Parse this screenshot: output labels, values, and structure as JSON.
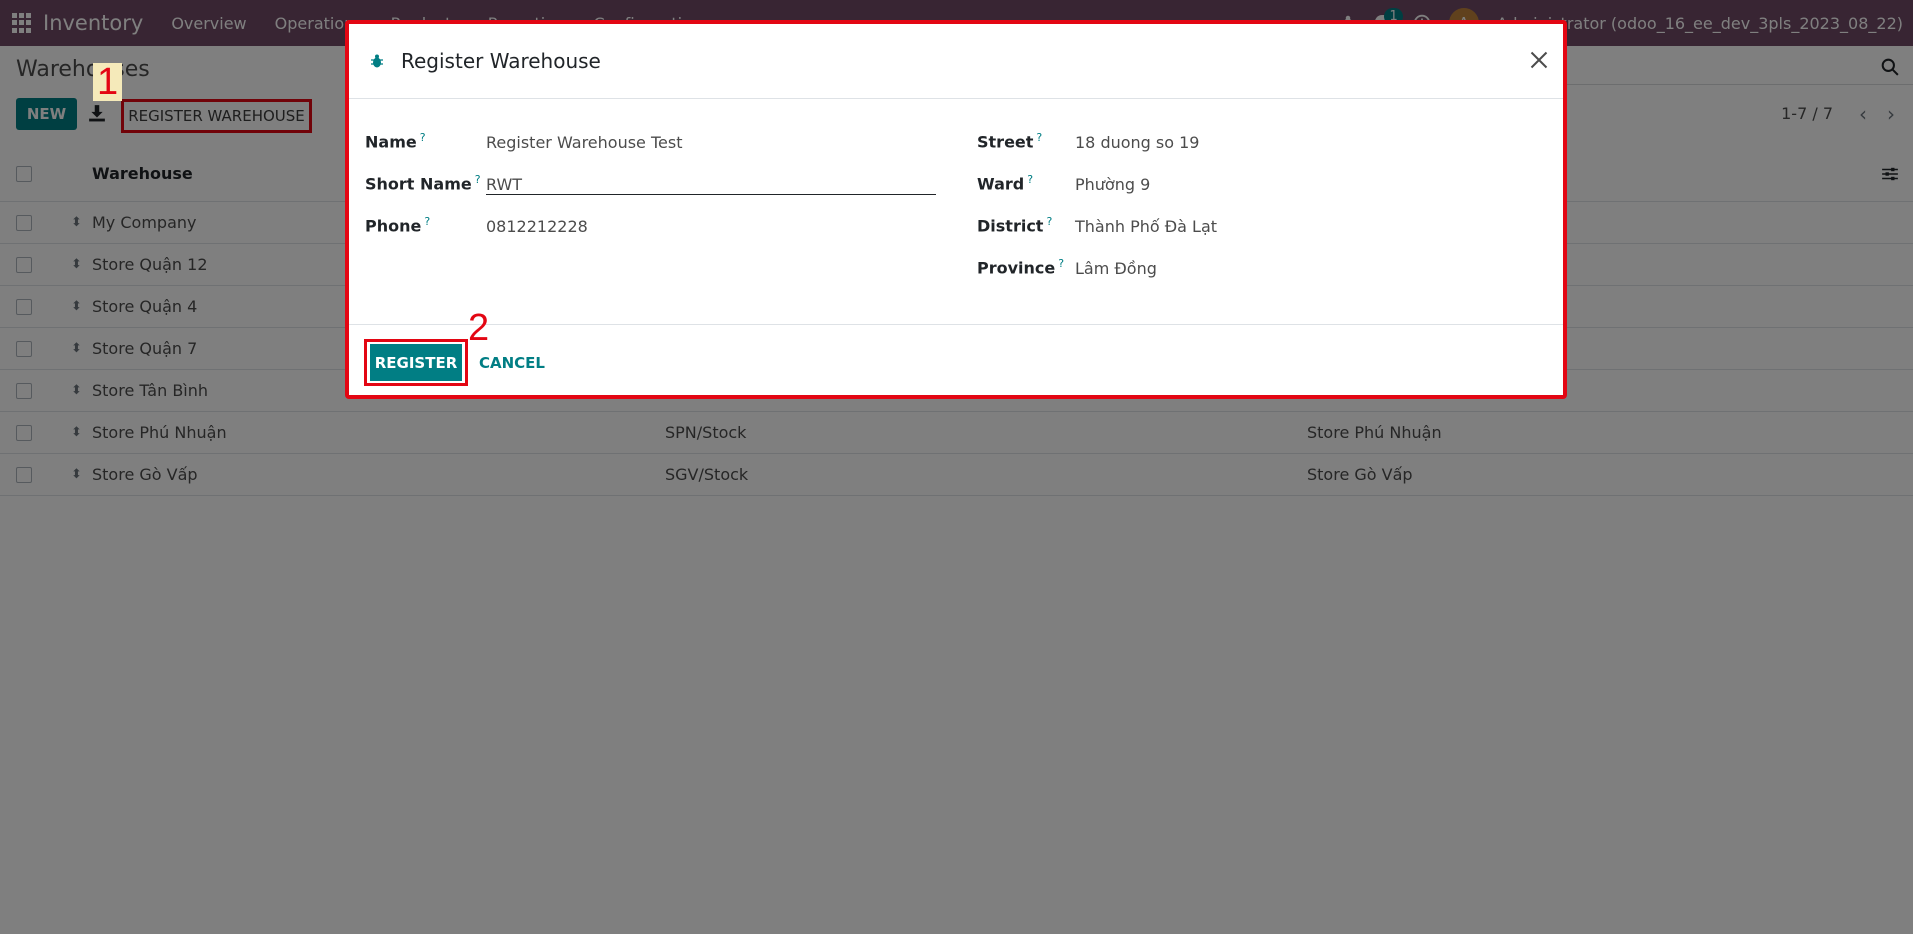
{
  "navbar": {
    "brand": "Inventory",
    "menu": [
      "Overview",
      "Operations",
      "Products",
      "Reporting",
      "Configuration"
    ],
    "chat_count": "1",
    "avatar_initial": "A",
    "user": "Administrator (odoo_16_ee_dev_3pls_2023_08_22)"
  },
  "control": {
    "title": "Warehouses",
    "new_label": "NEW",
    "register_warehouse_label": "REGISTER WAREHOUSE",
    "pager": "1-7 / 7"
  },
  "annotations": {
    "step1": "1",
    "step2": "2"
  },
  "list": {
    "header_name": "Warehouse",
    "rows": [
      {
        "name": "My Company",
        "location": "",
        "company": ""
      },
      {
        "name": "Store Quận 12",
        "location": "",
        "company": ""
      },
      {
        "name": "Store Quận 4",
        "location": "",
        "company": ""
      },
      {
        "name": "Store Quận 7",
        "location": "",
        "company": ""
      },
      {
        "name": "Store Tân Bình",
        "location": "",
        "company": ""
      },
      {
        "name": "Store Phú Nhuận",
        "location": "SPN/Stock",
        "company": "Store Phú Nhuận"
      },
      {
        "name": "Store Gò Vấp",
        "location": "SGV/Stock",
        "company": "Store Gò Vấp"
      }
    ]
  },
  "modal": {
    "title": "Register Warehouse",
    "fields_left": [
      {
        "label": "Name",
        "value": "Register Warehouse Test"
      },
      {
        "label": "Short Name",
        "value": "RWT"
      },
      {
        "label": "Phone",
        "value": "0812212228"
      }
    ],
    "fields_right": [
      {
        "label": "Street",
        "value": "18 duong so 19"
      },
      {
        "label": "Ward",
        "value": "Phường 9"
      },
      {
        "label": "District",
        "value": "Thành Phố Đà Lạt"
      },
      {
        "label": "Province",
        "value": "Lâm Đồng"
      }
    ],
    "help_mark": "?",
    "register_label": "REGISTER",
    "cancel_label": "CANCEL"
  },
  "colors": {
    "navbar": "#714b67",
    "primary": "#017e84",
    "highlight": "#e30613"
  }
}
